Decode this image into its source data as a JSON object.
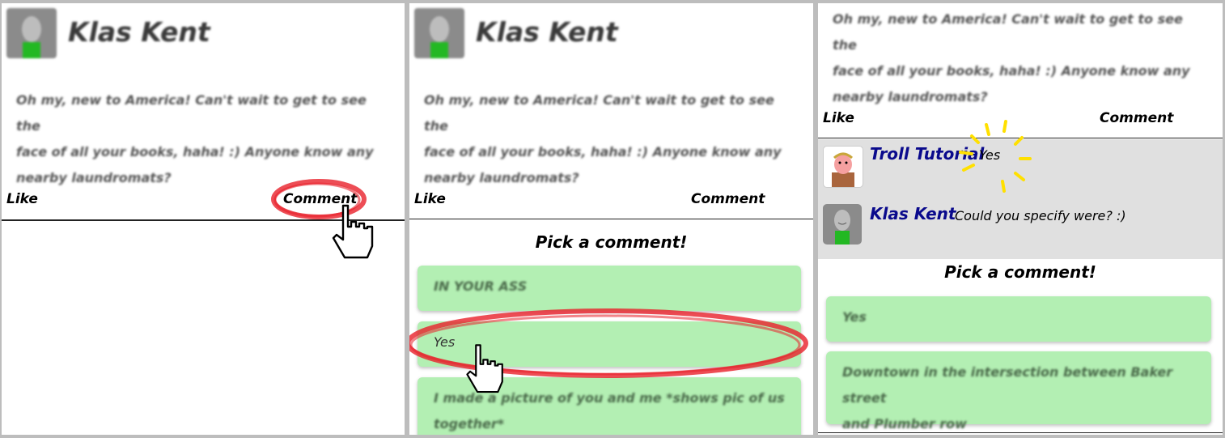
{
  "post": {
    "author": "Klas Kent",
    "text_lines": [
      "Oh my, new to America! Can't wait to get to see the",
      "face of all your books, haha! :) Anyone know any",
      "nearby laundromats?"
    ],
    "like_label": "Like",
    "comment_label": "Comment"
  },
  "picker": {
    "title": "Pick a comment!"
  },
  "panel2_options": [
    "IN YOUR ASS",
    "Yes",
    "I made a picture of you and me *shows pic of us",
    "together*"
  ],
  "panel3": {
    "comments": [
      {
        "author": "Troll Tutorial",
        "text": "Yes"
      },
      {
        "author": "Klas Kent",
        "text": "Could you specify were? :)"
      }
    ],
    "options": [
      "Yes",
      "Downtown in the intersection between Baker street",
      "and Plumber row"
    ]
  },
  "colors": {
    "option_bg": "#b3efb3",
    "comment_area_bg": "#e0e0e0",
    "author_link": "#0a0a8c",
    "highlight_scribble": "#e8202a",
    "sparkle": "#ffe000"
  }
}
